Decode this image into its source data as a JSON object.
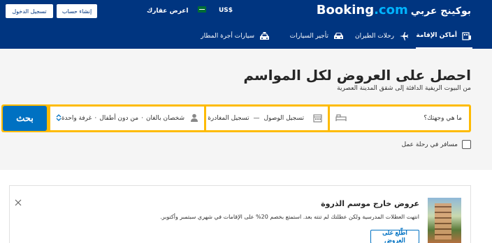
{
  "header": {
    "logo_main": "Booking",
    "logo_tld": ".com",
    "logo_suffix": "بوكينج عربي",
    "currency": "$US",
    "list_property": "اعرض عقارك",
    "register_label": "إنشاء حساب",
    "login_label": "تسجيل الدخول"
  },
  "nav": {
    "items": [
      {
        "label": "أماكن الإقامة",
        "icon": "bed-icon",
        "active": true
      },
      {
        "label": "رحلات الطيران",
        "icon": "plane-icon",
        "active": false
      },
      {
        "label": "تأجير السيارات",
        "icon": "car-icon",
        "active": false
      },
      {
        "label": "سيارات أجرة المطار",
        "icon": "taxi-icon",
        "active": false
      }
    ]
  },
  "hero": {
    "title": "احصل على العروض لكل المواسم",
    "subtitle": "من البيوت الريفية الدافئة إلى شقق المدينة العصرية"
  },
  "search": {
    "destination_placeholder": "ما هي وجهتك؟",
    "checkin_label": "تسجيل الوصول",
    "date_separator": "—",
    "checkout_label": "تسجيل المغادرة",
    "adults": "شخصان بالغان",
    "children": "من دون أطفال",
    "rooms": "غرفة واحدة",
    "dot": "·",
    "button_label": "بحث"
  },
  "work_trip": {
    "label": "مسافر في رحلة عمل"
  },
  "promo": {
    "title": "عروض خارج موسم الذروة",
    "description": "انتهت العطلات المدرسية ولكن عطلتك لم تنته بعد. استمتع بخصم 20% على الإقامات في شهري سبتمبر وأكتوبر.",
    "button_label": "اطّلع على العروض"
  },
  "colors": {
    "brand_blue": "#003580",
    "search_yellow": "#febb02",
    "button_blue": "#0071c2"
  }
}
